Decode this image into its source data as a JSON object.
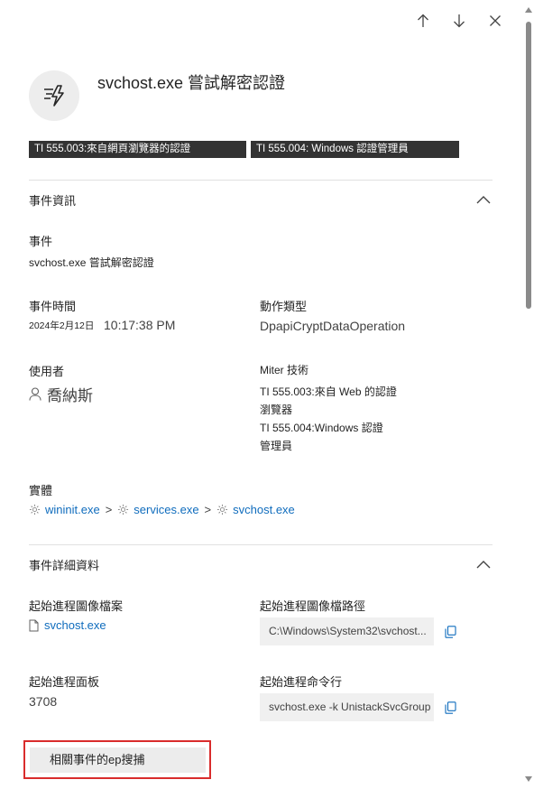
{
  "nav": {
    "up_icon": "arrow-up-icon",
    "down_icon": "arrow-down-icon",
    "close_icon": "close-icon"
  },
  "header": {
    "icon": "lightning-lines-icon",
    "title": "svchost.exe 嘗試解密認證"
  },
  "tags": [
    "TI 555.003:來自網頁瀏覽器的認證",
    "TI 555.004: Windows 認證管理員"
  ],
  "event_info": {
    "section_title": "事件資訊",
    "event_label": "事件",
    "event_value": "svchost.exe 嘗試解密認證",
    "time_label": "事件時間",
    "time_date": "2024年2月12日",
    "time_clock": "10:17:38 PM",
    "action_type_label": "動作類型",
    "action_type_value": "DpapiCryptDataOperation",
    "user_label": "使用者",
    "user_value": "喬納斯",
    "mitre_label": "Miter 技術",
    "mitre_line1": "TI 555.003:來自 Web 的認證",
    "mitre_line2": "瀏覽器",
    "mitre_line3": "TI 555.004:Windows 認證",
    "mitre_line4": "管理員",
    "entities_label": "實體",
    "entities": [
      "wininit.exe",
      "services.exe",
      "svchost.exe"
    ],
    "entity_separator": ">"
  },
  "event_details": {
    "section_title": "事件詳細資料",
    "image_file_label": "起始進程圖像檔案",
    "image_file_value": "svchost.exe",
    "image_path_label": "起始進程圖像檔路徑",
    "image_path_value": "C:\\Windows\\System32\\svchost...",
    "panel_label": "起始進程面板",
    "panel_value": "3708",
    "cmdline_label": "起始進程命令行",
    "cmdline_value": "svchost.exe -k UnistackSvcGroup"
  },
  "actions": {
    "related_events_label": "相關事件的ep搜捕"
  },
  "colors": {
    "link": "#0f6cbd",
    "tag_bg": "#333333",
    "highlight_border": "#d92c2c"
  }
}
